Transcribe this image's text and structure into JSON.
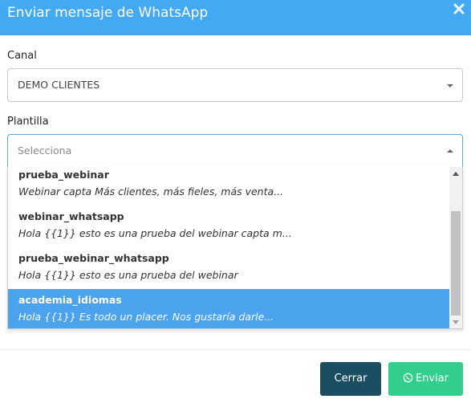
{
  "dialog": {
    "title": "Enviar mensaje de WhatsApp",
    "close_icon": "close-icon"
  },
  "canal": {
    "label": "Canal",
    "value": "DEMO CLIENTES"
  },
  "plantilla": {
    "label": "Plantilla",
    "placeholder": "Selecciona",
    "options": [
      {
        "name": "prueba_webinar",
        "description": "Webinar capta Más clientes, más fieles, más venta..."
      },
      {
        "name": "webinar_whatsapp",
        "description": "Hola {{1}} esto es una prueba del webinar capta m..."
      },
      {
        "name": "prueba_webinar_whatsapp",
        "description": "Hola {{1}} esto es una prueba del webinar"
      },
      {
        "name": "academia_idiomas",
        "description": "Hola {{1}} Es todo un placer. Nos gustaría darle..."
      }
    ],
    "highlighted_option": "academia_idiomas"
  },
  "footer": {
    "close_label": "Cerrar",
    "send_label": "Enviar",
    "send_icon": "whatsapp-icon"
  },
  "colors": {
    "header": "#43a9f2",
    "highlight": "#4ba3ee",
    "close_button": "#1b4d63",
    "send_button": "#31ce8c"
  }
}
